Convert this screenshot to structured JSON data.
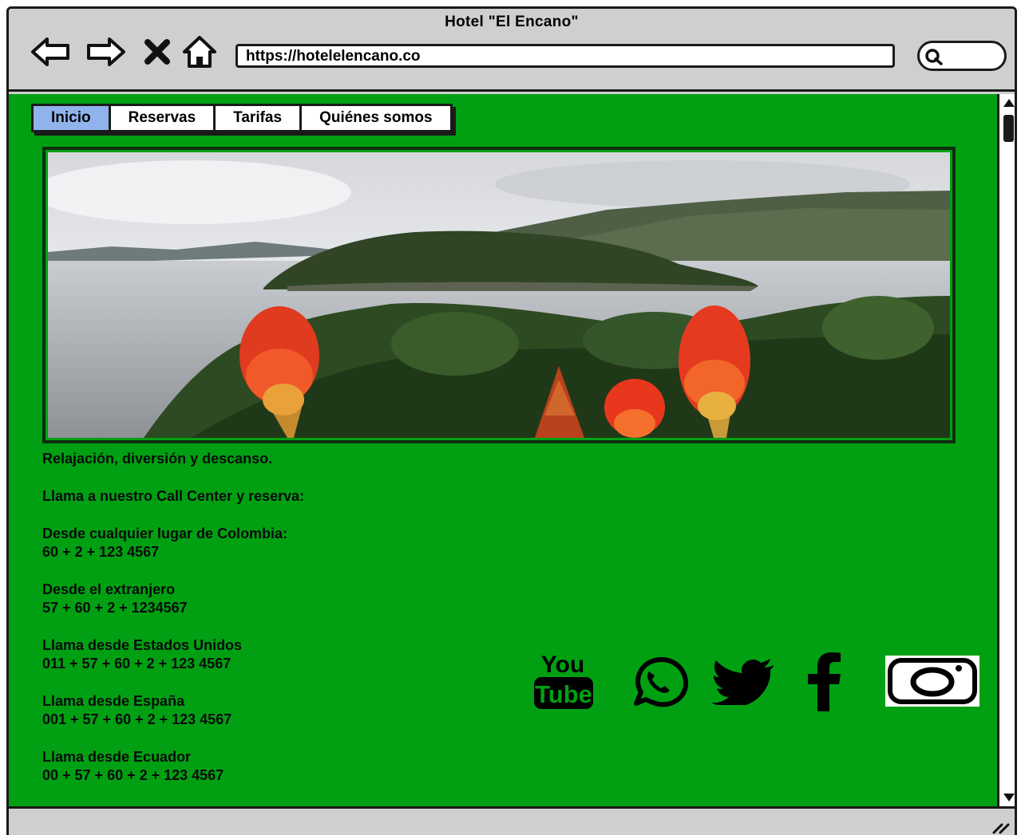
{
  "window": {
    "title": "Hotel \"El Encano\""
  },
  "toolbar": {
    "back_icon": "arrow-left-icon",
    "forward_icon": "arrow-right-icon",
    "stop_icon": "close-icon",
    "home_icon": "home-icon",
    "url": "https://hotelelencano.co",
    "search_icon": "search-icon"
  },
  "tabs": [
    {
      "label": "Inicio",
      "active": true
    },
    {
      "label": "Reservas",
      "active": false
    },
    {
      "label": "Tarifas",
      "active": false
    },
    {
      "label": "Quiénes somos",
      "active": false
    }
  ],
  "hero": {
    "description_icon": "landscape-image"
  },
  "info": {
    "tagline": "Relajación, diversión y descanso.",
    "call_center": "Llama a nuestro Call Center y reserva:",
    "contacts": [
      {
        "label": "Desde cualquier lugar de Colombia:",
        "number": "60 + 2 + 123 4567"
      },
      {
        "label": "Desde el extranjero",
        "number": "57 + 60 + 2 + 1234567"
      },
      {
        "label": "Llama desde Estados Unidos",
        "number": "011 + 57 + 60 + 2 + 123 4567"
      },
      {
        "label": "Llama desde España",
        "number": "001 + 57 + 60 + 2 + 123 4567"
      },
      {
        "label": "Llama desde Ecuador",
        "number": "00 + 57 + 60 + 2 + 123 4567"
      }
    ]
  },
  "social": {
    "youtube_top": "You",
    "youtube_bottom": "Tube",
    "icons": [
      "youtube-icon",
      "whatsapp-icon",
      "twitter-icon",
      "facebook-icon",
      "instagram-icon"
    ]
  },
  "colors": {
    "page_bg": "#00a012",
    "chrome": "#cfcfcf",
    "active_tab": "#8fb3ea",
    "outline": "#1a1a1a"
  }
}
